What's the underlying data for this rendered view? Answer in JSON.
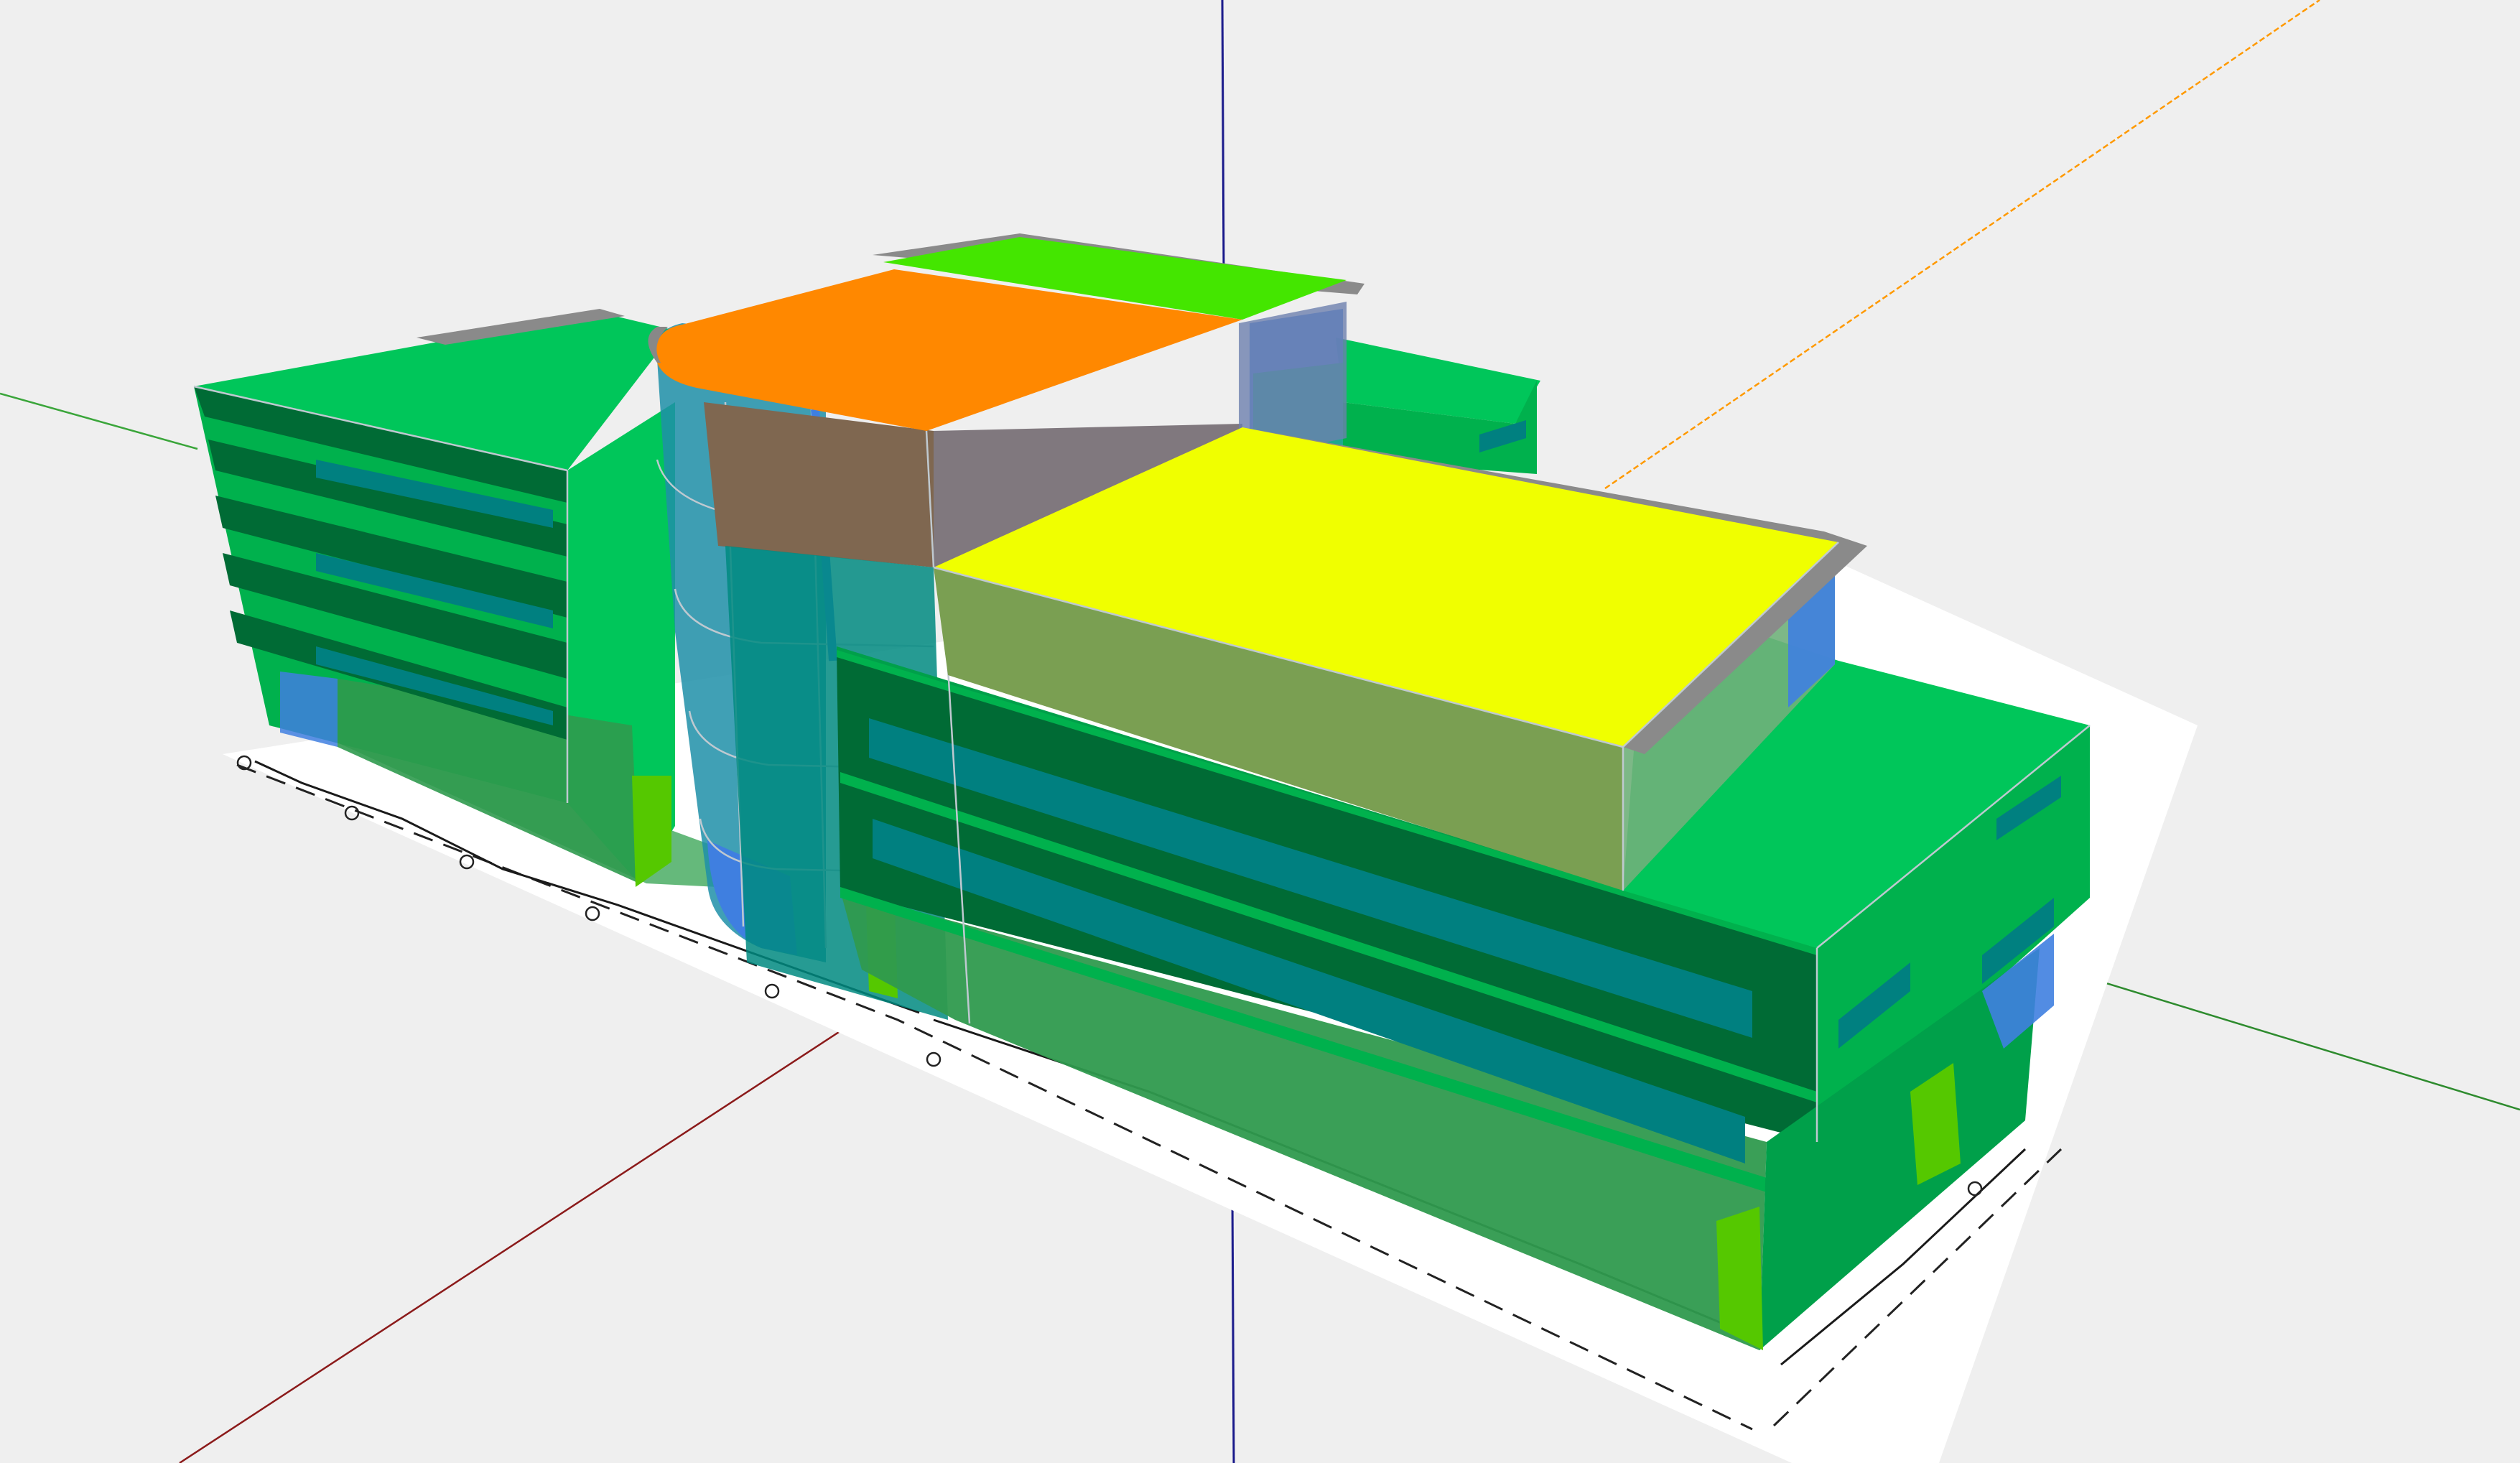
{
  "viewer": {
    "background": "#efefef",
    "axes": {
      "x_axis_color": "#8b1a1a",
      "y_axis_color": "#2e8b2e",
      "z_axis_color": "#1a1a8b",
      "y_axis_far_color": "#ff9900"
    }
  },
  "model": {
    "zone_colors": {
      "roof_orange": "#ff8800",
      "roof_yellow": "#f0ff00",
      "roof_light_green": "#44e600",
      "floor_green": "#00c65a",
      "band_dark_green": "#006b35",
      "window_teal": "#008080",
      "glass_blue": "#3f7fe0",
      "ground_green": "#2f9a4e",
      "brown_shadow": "#7f6750",
      "grey_glass": "#80787e",
      "olive_volume": "#7a9f52",
      "lime_column": "#55c800"
    },
    "zone_icons": [
      "orange-roof-zone",
      "yellow-roof-zone",
      "green-roof-zone",
      "curtain-wall-zone"
    ]
  }
}
